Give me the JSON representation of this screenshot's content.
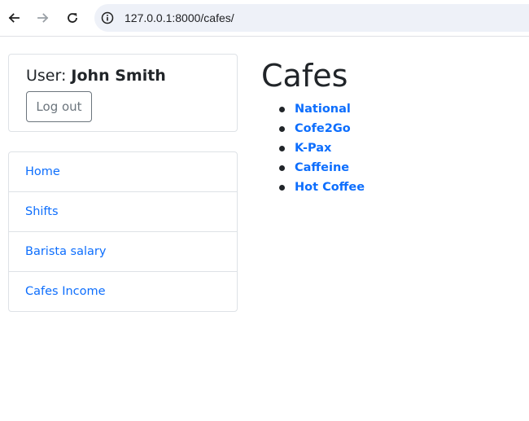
{
  "browser": {
    "url": "127.0.0.1:8000/cafes/",
    "icons": {
      "back": "arrow-left-icon",
      "forward": "arrow-right-icon",
      "reload": "reload-icon",
      "site_info": "info-circle-icon"
    }
  },
  "user_card": {
    "prefix": "User: ",
    "name": "John Smith",
    "logout_label": "Log out"
  },
  "sidebar": {
    "items": [
      {
        "label": "Home"
      },
      {
        "label": "Shifts"
      },
      {
        "label": "Barista salary"
      },
      {
        "label": "Cafes Income"
      }
    ]
  },
  "main": {
    "title": "Cafes",
    "cafes": [
      {
        "label": "National"
      },
      {
        "label": "Cofe2Go"
      },
      {
        "label": "K-Pax"
      },
      {
        "label": "Caffeine"
      },
      {
        "label": "Hot Coffee"
      }
    ]
  },
  "colors": {
    "link": "#0d6efd",
    "text": "#212529",
    "border": "#dee2e6",
    "secondary": "#6c757d",
    "address_bar": "#eef1f8"
  }
}
